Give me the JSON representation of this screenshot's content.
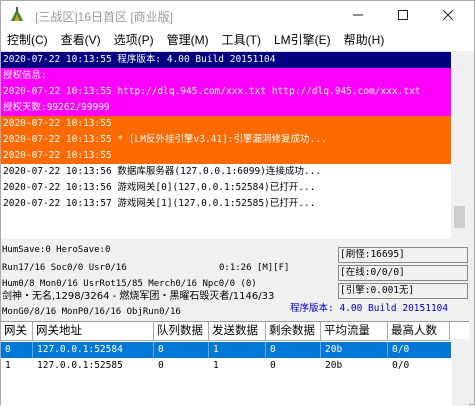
{
  "window": {
    "title": "[三战区]16日首区 [商业版]",
    "controls": [
      "minimize",
      "maximize",
      "close"
    ]
  },
  "menu": [
    {
      "label": "控制(C)"
    },
    {
      "label": "查看(V)"
    },
    {
      "label": "选项(P)"
    },
    {
      "label": "管理(M)"
    },
    {
      "label": "工具(T)"
    },
    {
      "label": "LM引擎(E)"
    },
    {
      "label": "帮助(H)"
    }
  ],
  "log": [
    {
      "text": "2020-07-22 10:13:55 程序版本: 4.00 Build 20151104",
      "bg": "#000080",
      "fg": "#ffffff"
    },
    {
      "text": "授权信息:",
      "bg": "#ff00ff",
      "fg": "#ffffff"
    },
    {
      "text": "2020-07-22 10:13:55 http://dlq.945.com/xxx.txt http://dlq.945.com/xxx.txt",
      "bg": "#ff00ff",
      "fg": "#ffffff"
    },
    {
      "text": "授权天数:99262/99999",
      "bg": "#ff00ff",
      "fg": "#ffffff"
    },
    {
      "text": "2020-07-22 10:13:55",
      "bg": "#ff6a00",
      "fg": "#ffffff"
    },
    {
      "text": "2020-07-22 10:13:55 * [LM反外挂引擎v3.41]:引擎漏洞修复成功...",
      "bg": "#ff6a00",
      "fg": "#ffffff"
    },
    {
      "text": "2020-07-22 10:13:55",
      "bg": "#ff6a00",
      "fg": "#ffffff"
    },
    {
      "text": "2020-07-22 10:13:56 数据库服务器(127.0.0.1:6099)连接成功...",
      "bg": "#ffffff",
      "fg": "#000000"
    },
    {
      "text": "2020-07-22 10:13:56 游戏网关[0](127.0.0.1:52584)已打开...",
      "bg": "#ffffff",
      "fg": "#000000"
    },
    {
      "text": "2020-07-22 10:13:57 游戏网关[1](127.0.0.1:52585)已打开...",
      "bg": "#ffffff",
      "fg": "#000000"
    }
  ],
  "status": {
    "line1": "HumSave:0 HeroSave:0",
    "line2": "Run17/16 Soc0/0 Usr0/16",
    "line2b": "0:1:26 [M][F]",
    "line3": "Hum0/8 Mon0/16 UsrRot15/85 Merch0/16 Npc0/0 (0)",
    "line4": "剑神・无名,1298/3264 - 燃烧军团・黑曜石毁灭者/1146/33",
    "line5": "MonG0/8/16 MonP0/16/16 ObjRun0/16",
    "refresh": "[刷怪:16695]",
    "online": "[在线:0/0/0]",
    "engine": "[引擎:0.001无]",
    "version": "程序版本: 4.00 Build 20151104"
  },
  "grid": {
    "columns": [
      "网关",
      "网关地址",
      "队列数据",
      "发送数据",
      "剩余数据",
      "平均流量",
      "最高人数"
    ],
    "rows": [
      [
        "0",
        "127.0.0.1:52584",
        "0",
        "1",
        "0",
        "20b",
        "0/0"
      ],
      [
        "1",
        "127.0.0.1:52585",
        "0",
        "1",
        "0",
        "20b",
        "0/0"
      ]
    ],
    "selected_row": 0
  },
  "colors": {
    "selection": "#0078d7",
    "version_text": "#0000c8"
  }
}
